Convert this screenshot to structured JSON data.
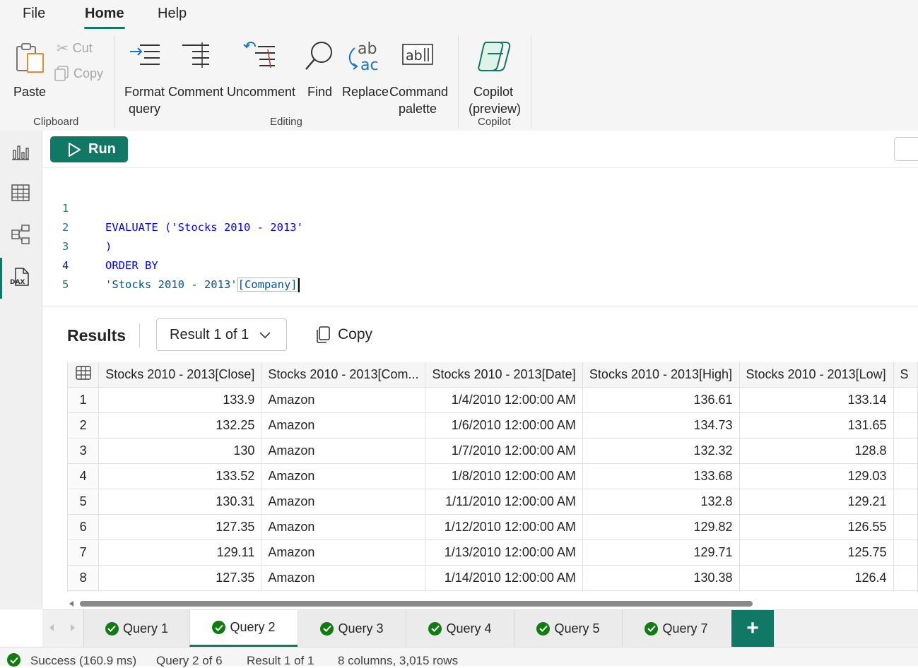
{
  "menu": {
    "file": "File",
    "home": "Home",
    "help": "Help"
  },
  "ribbon": {
    "paste": "Paste",
    "cut": "Cut",
    "copy": "Copy",
    "clipboard_group": "Clipboard",
    "format_query_1": "Format",
    "format_query_2": "query",
    "comment": "Comment",
    "uncomment": "Uncomment",
    "find": "Find",
    "replace": "Replace",
    "command_palette_1": "Command",
    "command_palette_2": "palette",
    "editing_group": "Editing",
    "copilot_1": "Copilot",
    "copilot_2": "(preview)",
    "copilot_group": "Copilot"
  },
  "rail": {
    "icons": [
      "report-view-icon",
      "table-view-icon",
      "model-view-icon",
      "dax-query-view-icon"
    ],
    "active": "dax-query-view-icon"
  },
  "editor": {
    "run_label": "Run",
    "lines": [
      {
        "n": "1",
        "kw": "EVALUATE",
        "rest": " ('Stocks 2010 - 2013'"
      },
      {
        "n": "2",
        "rest": ")"
      },
      {
        "n": "3",
        "kw": "ORDER BY"
      },
      {
        "n": "4",
        "table": "'Stocks 2010 - 2013'",
        "col": "[Company]"
      },
      {
        "n": "5"
      }
    ]
  },
  "results": {
    "title": "Results",
    "selector": "Result 1 of 1",
    "copy_label": "Copy",
    "columns": [
      "Stocks 2010 - 2013[Close]",
      "Stocks 2010 - 2013[Com...",
      "Stocks 2010 - 2013[Date]",
      "Stocks 2010 - 2013[High]",
      "Stocks 2010 - 2013[Low]",
      "S"
    ],
    "rows": [
      [
        "1",
        "133.9",
        "Amazon",
        "1/4/2010 12:00:00 AM",
        "136.61",
        "133.14"
      ],
      [
        "2",
        "132.25",
        "Amazon",
        "1/6/2010 12:00:00 AM",
        "134.73",
        "131.65"
      ],
      [
        "3",
        "130",
        "Amazon",
        "1/7/2010 12:00:00 AM",
        "132.32",
        "128.8"
      ],
      [
        "4",
        "133.52",
        "Amazon",
        "1/8/2010 12:00:00 AM",
        "133.68",
        "129.03"
      ],
      [
        "5",
        "130.31",
        "Amazon",
        "1/11/2010 12:00:00 AM",
        "132.8",
        "129.21"
      ],
      [
        "6",
        "127.35",
        "Amazon",
        "1/12/2010 12:00:00 AM",
        "129.82",
        "126.55"
      ],
      [
        "7",
        "129.11",
        "Amazon",
        "1/13/2010 12:00:00 AM",
        "129.71",
        "125.75"
      ],
      [
        "8",
        "127.35",
        "Amazon",
        "1/14/2010 12:00:00 AM",
        "130.38",
        "126.4"
      ],
      [
        "",
        "",
        "",
        "",
        "",
        ""
      ]
    ]
  },
  "tabs": {
    "items": [
      "Query 1",
      "Query 2",
      "Query 3",
      "Query 4",
      "Query 5",
      "Query 7"
    ],
    "active_index": 1,
    "add_label": "+"
  },
  "status": {
    "success": "Success (160.9 ms)",
    "query": "Query 2 of 6",
    "result": "Result 1 of 1",
    "shape": "8 columns, 3,015 rows"
  },
  "colors": {
    "accent": "#117865",
    "success": "#107c10",
    "keyword": "#0000ff",
    "string": "#a31515",
    "line_number": "#237893"
  }
}
